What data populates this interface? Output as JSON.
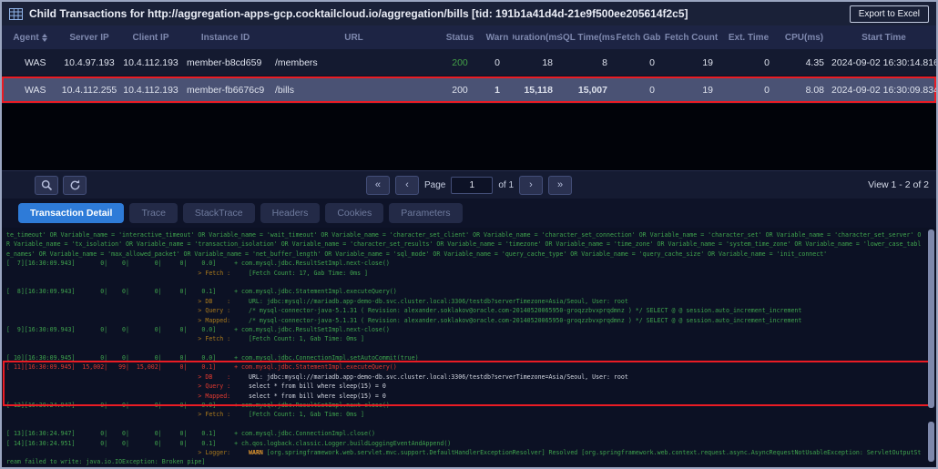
{
  "window": {
    "title": "Child Transactions for http://aggregation-apps-gcp.cocktailcloud.io/aggregation/bills [tid: 191b1a41d4d-21e9f500ee205614f2c5]",
    "export_button": "Export to Excel"
  },
  "table": {
    "columns": [
      "Agent",
      "Server IP",
      "Client IP",
      "Instance ID",
      "URL",
      "Status",
      "Warn",
      "Duration(ms)",
      "SQL Time(ms)",
      "Fetch Gab",
      "Fetch Count",
      "Ext. Time",
      "CPU(ms)",
      "Start Time"
    ],
    "rows": [
      {
        "agent": "WAS",
        "server_ip": "10.4.97.193",
        "client_ip": "10.4.112.193",
        "instance_id": "member-b8cd659",
        "url": "/members",
        "status": "200",
        "status_color": "green",
        "warn": "0",
        "duration": "18",
        "sql_time": "8",
        "fetch_gab": "0",
        "fetch_count": "19",
        "ext_time": "0",
        "cpu": "4.35",
        "start_time": "2024-09-02 16:30:14.816",
        "selected": false
      },
      {
        "agent": "WAS",
        "server_ip": "10.4.112.255",
        "client_ip": "10.4.112.193",
        "instance_id": "member-fb6676c9",
        "url": "/bills",
        "status": "200",
        "status_color": "white",
        "warn": "1",
        "duration": "15,118",
        "sql_time": "15,007",
        "fetch_gab": "0",
        "fetch_count": "19",
        "ext_time": "0",
        "cpu": "8.08",
        "start_time": "2024-09-02 16:30:09.834",
        "selected": true
      }
    ]
  },
  "pagination": {
    "first": "«",
    "prev": "‹",
    "page_label": "Page",
    "page_value": "1",
    "of_label": "of 1",
    "next": "›",
    "last": "»",
    "view_text": "View 1 - 2 of 2"
  },
  "tabs": [
    {
      "label": "Transaction Detail",
      "active": true
    },
    {
      "label": "Trace",
      "active": false
    },
    {
      "label": "StackTrace",
      "active": false
    },
    {
      "label": "Headers",
      "active": false
    },
    {
      "label": "Cookies",
      "active": false
    },
    {
      "label": "Parameters",
      "active": false
    }
  ],
  "console": {
    "highlight": {
      "start": 14,
      "end": 17
    },
    "lines": [
      {
        "segs": [
          {
            "t": "te_timeout' OR Variable_name = 'interactive_timeout' OR Variable_name = 'wait_timeout' OR Variable_name = 'character_set_client' OR Variable_name = 'character_set_connection' OR Variable_name = 'character_set' OR Variable_name = 'character_set_server' O",
            "c": "g"
          }
        ]
      },
      {
        "segs": [
          {
            "t": "R Variable_name = 'tx_isolation' OR Variable_name = 'transaction_isolation' OR Variable_name = 'character_set_results' OR Variable_name = 'timezone' OR Variable_name = 'time_zone' OR Variable_name = 'system_time_zone' OR Variable_name = 'lower_case_tabl",
            "c": "g"
          }
        ]
      },
      {
        "segs": [
          {
            "t": "e_names' OR Variable_name = 'max_allowed_packet' OR Variable_name = 'net_buffer_length' OR Variable_name = 'sql_mode' OR Variable_name = 'query_cache_type' OR Variable_name = 'query_cache_size' OR Variable_name = 'init_connect'",
            "c": "g"
          }
        ]
      },
      {
        "segs": [
          {
            "t": "[  7][16:30:09.943]       0|    0|       0|     0|    0.0]     + com.mysql.jdbc.ResultSetImpl.next-close()",
            "c": "g"
          }
        ]
      },
      {
        "indent": 53,
        "segs": [
          {
            "t": "> Fetch :",
            "c": "o"
          },
          {
            "t": "     [Fetch Count: 17, Gab Time: 0ms ]",
            "c": "g"
          }
        ]
      },
      {
        "segs": []
      },
      {
        "segs": [
          {
            "t": "[  8][16:30:09.943]       0|    0|       0|     0|    0.1]     + com.mysql.jdbc.StatementImpl.executeQuery()",
            "c": "g"
          }
        ]
      },
      {
        "indent": 53,
        "segs": [
          {
            "t": "> DB    :",
            "c": "o"
          },
          {
            "t": "     URL: jdbc:mysql://mariadb.app-demo-db.svc.cluster.local:3306/testdb?serverTimezone=Asia/Seoul, User: root",
            "c": "g"
          }
        ]
      },
      {
        "indent": 53,
        "segs": [
          {
            "t": "> Query :",
            "c": "o"
          },
          {
            "t": "     /* mysql-connector-java-5.1.31 ( Revision: alexander.soklakov@oracle.com-20140520065950-groqzzbvxprqdmnz ) */ SELECT @ @ session.auto_increment_increment",
            "c": "g"
          }
        ]
      },
      {
        "indent": 53,
        "segs": [
          {
            "t": "> Mapped:",
            "c": "o"
          },
          {
            "t": "     /* mysql-connector-java-5.1.31 ( Revision: alexander.soklakov@oracle.com-20140520065950-groqzzbvxprqdmnz ) */ SELECT @ @ session.auto_increment_increment",
            "c": "g"
          }
        ]
      },
      {
        "segs": [
          {
            "t": "[  9][16:30:09.943]       0|    0|       0|     0|    0.0]     + com.mysql.jdbc.ResultSetImpl.next-close()",
            "c": "g"
          }
        ]
      },
      {
        "indent": 53,
        "segs": [
          {
            "t": "> Fetch :",
            "c": "o"
          },
          {
            "t": "     [Fetch Count: 1, Gab Time: 0ms ]",
            "c": "g"
          }
        ]
      },
      {
        "segs": []
      },
      {
        "segs": [
          {
            "t": "[ 10][16:30:09.945]       0|    0|       0|     0|    0.0]     + com.mysql.jdbc.ConnectionImpl.setAutoCommit(true)",
            "c": "g"
          }
        ]
      },
      {
        "segs": [
          {
            "t": "[ 11][16:30:09.945]  15,002|   99|  15,002|     0|    0.1]     + com.mysql.jdbc.StatementImpl.executeQuery()",
            "c": "r"
          }
        ]
      },
      {
        "indent": 53,
        "segs": [
          {
            "t": "> DB    :",
            "c": "r"
          },
          {
            "t": "     URL: jdbc:mysql://mariadb.app-demo-db.svc.cluster.local:3306/testdb?serverTimezone=Asia/Seoul, User: root",
            "c": "wh"
          }
        ]
      },
      {
        "indent": 53,
        "segs": [
          {
            "t": "> Query :",
            "c": "r"
          },
          {
            "t": "     select * from bill where sleep(15) = 0",
            "c": "wh"
          }
        ]
      },
      {
        "indent": 53,
        "segs": [
          {
            "t": "> Mapped:",
            "c": "r"
          },
          {
            "t": "     select * from bill where sleep(15) = 0",
            "c": "wh"
          }
        ]
      },
      {
        "segs": [
          {
            "t": "[ 12][16:30:24.947]       0|    0|       0|     0|    0.0]     + com.mysql.jdbc.ResultSetImpl.next-close()",
            "c": "g"
          }
        ]
      },
      {
        "indent": 53,
        "segs": [
          {
            "t": "> Fetch :",
            "c": "o"
          },
          {
            "t": "     [Fetch Count: 1, Gab Time: 0ms ]",
            "c": "g"
          }
        ]
      },
      {
        "segs": []
      },
      {
        "segs": [
          {
            "t": "[ 13][16:30:24.947]       0|    0|       0|     0|    0.1]     + com.mysql.jdbc.ConnectionImpl.close()",
            "c": "g"
          }
        ]
      },
      {
        "segs": [
          {
            "t": "[ 14][16:30:24.951]       0|    0|       0|     0|    0.1]     + ch.qos.logback.classic.Logger.buildLoggingEventAndAppend()",
            "c": "g"
          }
        ]
      },
      {
        "indent": 53,
        "segs": [
          {
            "t": "> Logger:",
            "c": "o"
          },
          {
            "t": "     ",
            "c": "g"
          },
          {
            "t": "WARN",
            "c": "w"
          },
          {
            "t": " [org.springframework.web.servlet.mvc.support.DefaultHandlerExceptionResolver] Resolved [org.springframework.web.context.request.async.AsyncRequestNotUsableException: ServletOutputSt",
            "c": "g"
          }
        ]
      },
      {
        "segs": [
          {
            "t": "ream failed to write: java.io.IOException: Broken pipe]",
            "c": "g"
          }
        ]
      }
    ]
  },
  "colors": {
    "accent_blue": "#2e7bd8",
    "highlight_red": "#ea1c24",
    "status_green": "#43a047",
    "log_green": "#3fa34d",
    "log_label_orange": "#a9791c",
    "log_warn_orange": "#e0962e",
    "log_red": "#e23a30"
  }
}
